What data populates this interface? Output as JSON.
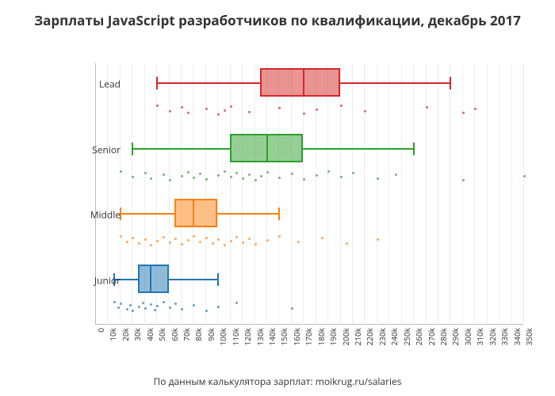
{
  "title": "Зарплаты JavaScript разработчиков по квалификации, декабрь 2017",
  "xcaption": "По данным калькулятора зарплат: moikrug.ru/salaries",
  "xticks": [
    "0",
    "10k",
    "20k",
    "30k",
    "40k",
    "50k",
    "60k",
    "70k",
    "80k",
    "90k",
    "100k",
    "110k",
    "120k",
    "130k",
    "140k",
    "150k",
    "160k",
    "170k",
    "180k",
    "190k",
    "200k",
    "210k",
    "220k",
    "230k",
    "240k",
    "250k",
    "260k",
    "270k",
    "280k",
    "290k",
    "300k",
    "310k",
    "320k",
    "330k",
    "340k",
    "350k"
  ],
  "ylabels": [
    "Lead",
    "Senior",
    "Middle",
    "Junior"
  ],
  "colors": {
    "Lead": {
      "stroke": "#d62728",
      "fill": "rgba(214,39,40,0.5)"
    },
    "Senior": {
      "stroke": "#2ca02c",
      "fill": "rgba(44,160,44,0.5)"
    },
    "Middle": {
      "stroke": "#ff7f0e",
      "fill": "rgba(255,127,14,0.5)"
    },
    "Junior": {
      "stroke": "#1f77b4",
      "fill": "rgba(31,119,180,0.5)"
    }
  },
  "chart_data": {
    "type": "box",
    "xlabel": "",
    "ylabel": "",
    "xlim": [
      0,
      350
    ],
    "units": "thousand RUB",
    "series": [
      {
        "name": "Lead",
        "q1": 135,
        "median": 170,
        "q3": 200,
        "whisker_low": 50,
        "whisker_high": 290,
        "points": [
          50,
          60,
          70,
          75,
          90,
          100,
          105,
          110,
          125,
          150,
          170,
          180,
          200,
          220,
          270,
          300,
          310
        ]
      },
      {
        "name": "Senior",
        "q1": 110,
        "median": 140,
        "q3": 170,
        "whisker_low": 30,
        "whisker_high": 260,
        "points": [
          20,
          30,
          40,
          45,
          55,
          60,
          70,
          75,
          80,
          85,
          90,
          100,
          105,
          110,
          115,
          120,
          125,
          130,
          135,
          140,
          150,
          160,
          170,
          180,
          190,
          200,
          210,
          230,
          245,
          300,
          350
        ]
      },
      {
        "name": "Middle",
        "q1": 65,
        "median": 80,
        "q3": 100,
        "whisker_low": 20,
        "whisker_high": 150,
        "points": [
          20,
          25,
          30,
          35,
          40,
          45,
          50,
          55,
          60,
          65,
          70,
          75,
          80,
          85,
          90,
          95,
          100,
          105,
          110,
          115,
          120,
          125,
          130,
          140,
          150,
          165,
          185,
          205,
          230
        ]
      },
      {
        "name": "Junior",
        "q1": 35,
        "median": 45,
        "q3": 60,
        "whisker_low": 15,
        "whisker_high": 100,
        "points": [
          15,
          18,
          20,
          25,
          28,
          30,
          35,
          38,
          40,
          45,
          48,
          50,
          55,
          60,
          65,
          70,
          80,
          90,
          100,
          115,
          160
        ]
      }
    ]
  }
}
